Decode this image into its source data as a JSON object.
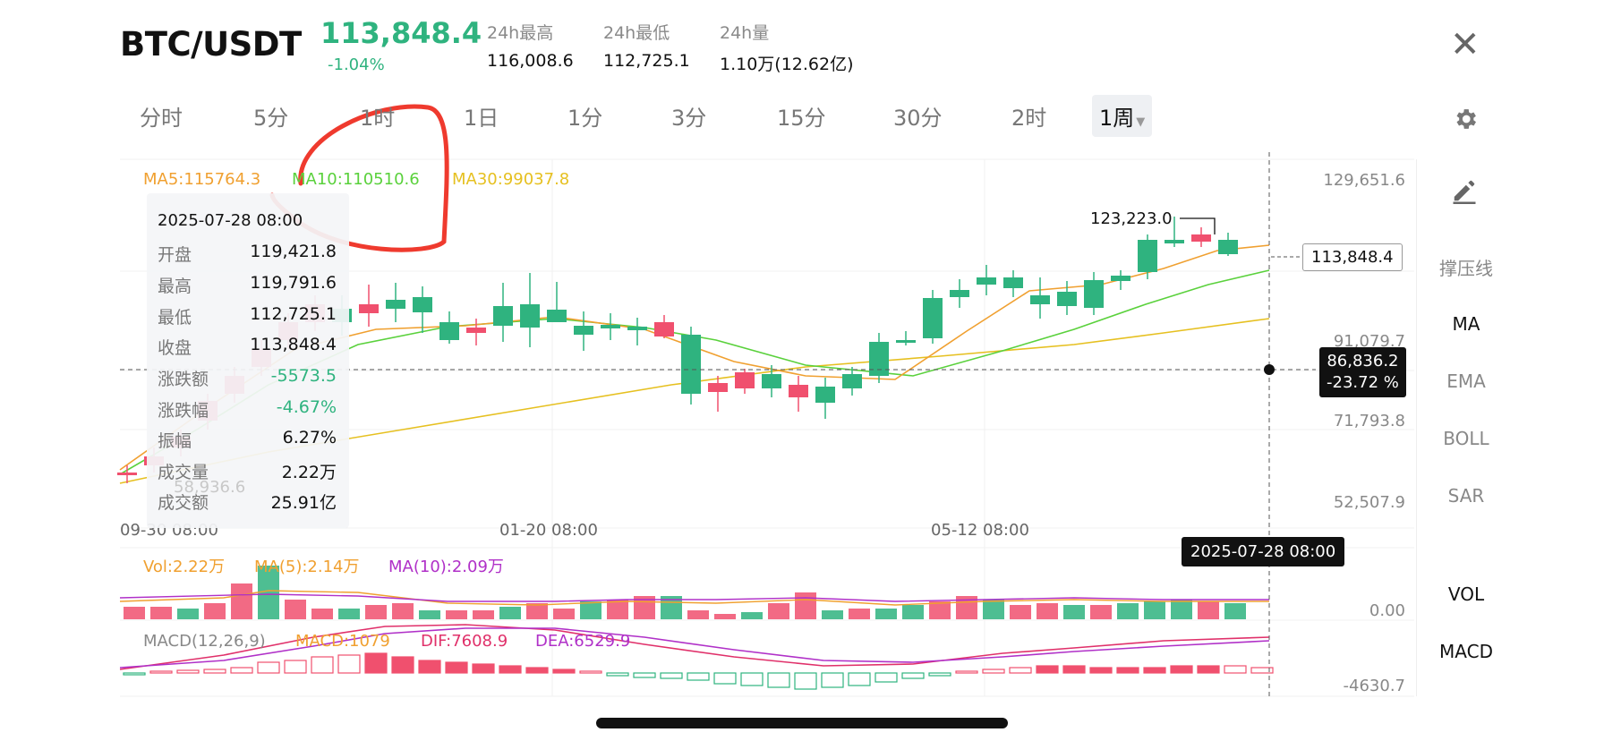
{
  "header": {
    "pair": "BTC/USDT",
    "price": "113,848.4",
    "change_pct": "-1.04%",
    "stats": [
      {
        "label": "24h最高",
        "value": "116,008.6"
      },
      {
        "label": "24h最低",
        "value": "112,725.1"
      },
      {
        "label": "24h量",
        "value": "1.10万(12.62亿)"
      }
    ],
    "close_icon": "close-icon"
  },
  "timeframes": [
    "分时",
    "5分",
    "1时",
    "1日",
    "1分",
    "3分",
    "15分",
    "30分",
    "2时",
    "1周"
  ],
  "active_timeframe": "1周",
  "ma_labels": {
    "ma5": "MA5:115764.3",
    "ma10": "MA10:110510.6",
    "ma30": "MA30:99037.8"
  },
  "price_axis": [
    "129,651.6",
    "91,079.7",
    "71,793.8",
    "52,507.9"
  ],
  "date_axis": [
    "09-30 08:00",
    "01-20 08:00",
    "05-12 08:00"
  ],
  "info_panel": {
    "date": "2025-07-28 08:00",
    "rows": [
      {
        "k": "开盘",
        "v": "119,421.8"
      },
      {
        "k": "最高",
        "v": "119,791.6"
      },
      {
        "k": "最低",
        "v": "112,725.1"
      },
      {
        "k": "收盘",
        "v": "113,848.4"
      },
      {
        "k": "涨跌额",
        "v": "-5573.5"
      },
      {
        "k": "涨跌幅",
        "v": "-4.67%"
      },
      {
        "k": "振幅",
        "v": "6.27%"
      },
      {
        "k": "成交量",
        "v": "2.22万"
      },
      {
        "k": "成交额",
        "v": "25.91亿"
      }
    ],
    "low_marker": "58,936.6"
  },
  "chart_badges": {
    "high_label": "123,223.0",
    "current_price": "113,848.4",
    "crosshair_price": "86,836.2",
    "crosshair_pct": "-23.72 %",
    "crosshair_date": "2025-07-28 08:00"
  },
  "right_panel": {
    "pencil_icon": "pencil-icon",
    "items": [
      "撑压线",
      "MA",
      "EMA",
      "BOLL",
      "SAR",
      "VOL",
      "MACD"
    ]
  },
  "volume": {
    "vol": "Vol:2.22万",
    "ma5": "MA(5):2.14万",
    "ma10": "MA(10):2.09万",
    "axis": "0.00"
  },
  "macd": {
    "title": "MACD(12,26,9)",
    "macd": "MACD:1079",
    "dif": "DIF:7608.9",
    "dea": "DEA:6529.9",
    "axis": "-4630.7"
  },
  "colors": {
    "up": "#2fb37f",
    "down": "#f0506e",
    "ma5": "#f0a030",
    "ma10": "#5ad13c",
    "ma30": "#e6c020",
    "macd_purple": "#b030c8"
  }
}
